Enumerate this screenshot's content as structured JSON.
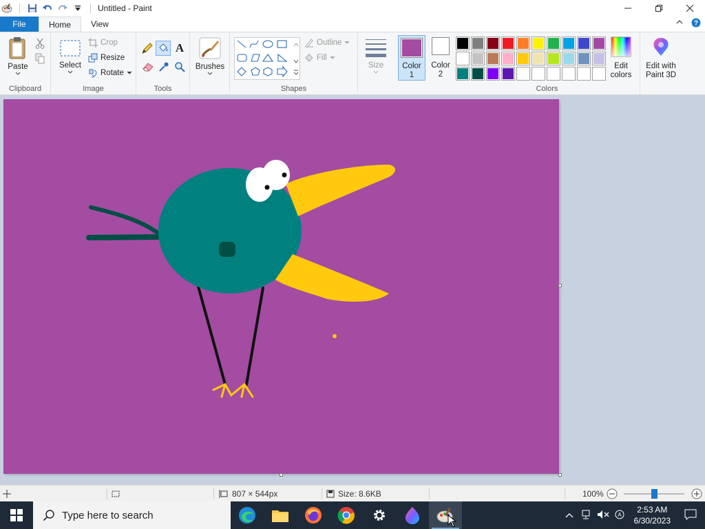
{
  "window": {
    "title": "Untitled - Paint",
    "controls": {
      "minimize": "—",
      "restore": "❐",
      "close": "✕"
    }
  },
  "tabs": {
    "file": "File",
    "home": "Home",
    "view": "View"
  },
  "ribbon": {
    "clipboard": {
      "label": "Clipboard",
      "paste": "Paste"
    },
    "image": {
      "label": "Image",
      "select": "Select",
      "crop": "Crop",
      "resize": "Resize",
      "rotate": "Rotate"
    },
    "tools": {
      "label": "Tools"
    },
    "brushes": {
      "label": "Brushes"
    },
    "shapes": {
      "label": "Shapes",
      "outline": "Outline",
      "fill": "Fill"
    },
    "size": {
      "label": "Size"
    },
    "color1": {
      "label1": "Color",
      "label2": "1",
      "value": "#a34ca2"
    },
    "color2": {
      "label1": "Color",
      "label2": "2",
      "value": "#ffffff"
    },
    "colors": {
      "label": "Colors",
      "swatches": [
        "#000000",
        "#7f7f7f",
        "#880015",
        "#ed1c24",
        "#ff7f27",
        "#fff200",
        "#22b14c",
        "#00a2e8",
        "#3f48cc",
        "#a349a4",
        "#ffffff",
        "#c3c3c3",
        "#b97a57",
        "#ffaec9",
        "#ffc90e",
        "#efe4b0",
        "#b5e61d",
        "#99d9ea",
        "#7092be",
        "#c8bfe7",
        "#00807f",
        "#004e45",
        "#7f00ff",
        "#5e17b3",
        "#ffffff",
        "#ffffff",
        "#ffffff",
        "#ffffff",
        "#ffffff",
        "#ffffff"
      ]
    },
    "edit_colors": {
      "line1": "Edit",
      "line2": "colors"
    },
    "paint3d": {
      "line1": "Edit with",
      "line2": "Paint 3D"
    }
  },
  "drawing": {
    "background": "#a34ca2",
    "body_color": "#00807f",
    "beak_color": "#ffc90e",
    "leg_color": "#111111",
    "tail_color": "#004e45"
  },
  "status": {
    "dimensions": "807 × 544px",
    "size": "Size: 8.6KB",
    "zoom": "100%",
    "zoom_level": 1.0
  },
  "taskbar": {
    "search_placeholder": "Type here to search",
    "time": "2:53 AM",
    "date": "6/30/2023"
  }
}
